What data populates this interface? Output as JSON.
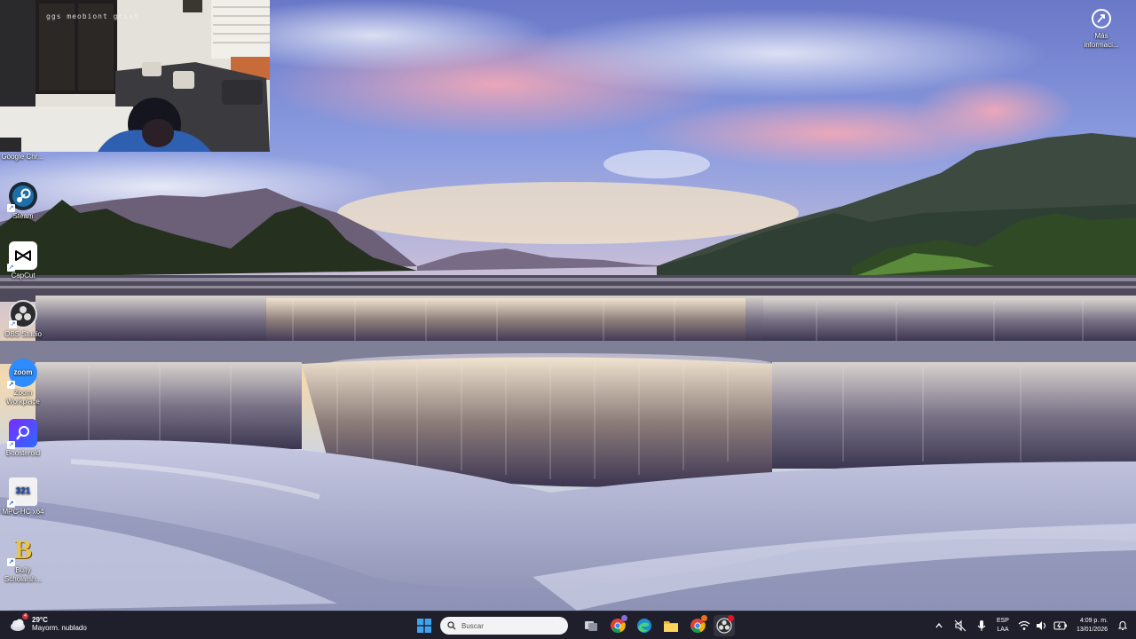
{
  "desktop": {
    "corner_widget": {
      "label_line1": "Más",
      "label_line2": "informaci..."
    },
    "webcam": {
      "caption": "ggs meobiont grist",
      "app_label": "Google Chr..."
    },
    "icons": [
      {
        "label": "Steam",
        "icon": "steam-icon"
      },
      {
        "label": "CapCut",
        "icon": "capcut-icon"
      },
      {
        "label": "OBS Studio",
        "icon": "obs-icon"
      },
      {
        "label_line1": "Zoom",
        "label_line2": "Workplace",
        "icon": "zoom-icon",
        "badge_text": "zoom"
      },
      {
        "label": "Boosteroid",
        "icon": "boosteroid-icon"
      },
      {
        "label": "MPC-HC x64",
        "icon": "mpc-hc-icon",
        "badge_text": "321"
      },
      {
        "label_line1": "Bully",
        "label_line2": "Scholarsh...",
        "icon": "bully-icon",
        "badge_text": "B"
      }
    ]
  },
  "taskbar": {
    "weather": {
      "temperature": "29°C",
      "condition": "Mayorm. nublado",
      "alert_count": "4"
    },
    "search_placeholder": "Buscar",
    "apps": [
      "windows-start-icon",
      "task-view-icon",
      "chrome-icon",
      "edge-icon",
      "file-explorer-icon",
      "chrome-profile-icon",
      "obs-taskbar-icon"
    ],
    "language": {
      "line1": "ESP",
      "line2": "LAA"
    },
    "clock": {
      "time": "4:09 p. m.",
      "date": "13/01/2026"
    }
  }
}
